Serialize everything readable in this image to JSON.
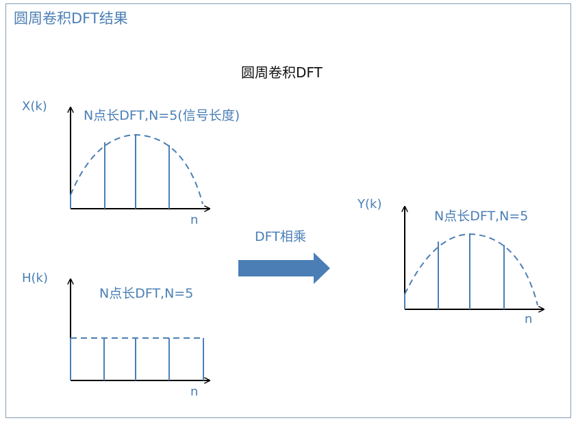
{
  "header": {
    "title": "圆周卷积DFT结果"
  },
  "diagram": {
    "title": "圆周卷积DFT",
    "x_panel": {
      "axis_label": "X(k)",
      "note": "N点长DFT,N=5(信号长度)",
      "x_axis": "n"
    },
    "h_panel": {
      "axis_label": "H(k)",
      "note": "N点长DFT,N=5",
      "x_axis": "n"
    },
    "y_panel": {
      "axis_label": "Y(k)",
      "note": "N点长DFT,N=5",
      "x_axis": "n"
    },
    "arrow_label": "DFT相乘"
  },
  "colors": {
    "accent": "#4a7eb5",
    "arrow": "#4a7eb5",
    "border": "#7f9db9"
  }
}
